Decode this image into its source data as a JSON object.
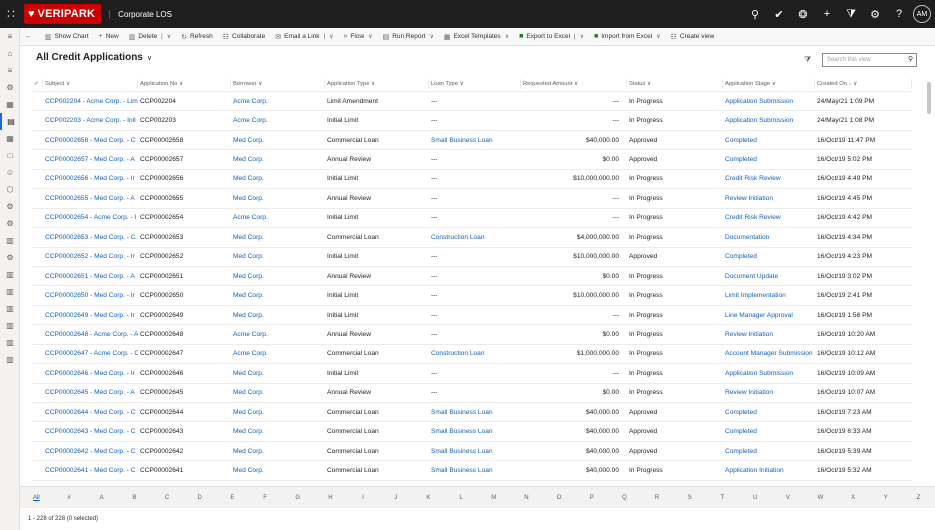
{
  "topbar": {
    "brand": "VERIPARK",
    "app_name": "Corporate LOS",
    "avatar_initials": "AM"
  },
  "commands": [
    {
      "label": "Show Chart",
      "icon": "chart-icon"
    },
    {
      "label": "New",
      "icon": "plus-icon"
    },
    {
      "label": "Delete",
      "icon": "trash-icon"
    },
    {
      "label": "Refresh",
      "icon": "refresh-icon"
    },
    {
      "label": "Collaborate",
      "icon": "collaborate-icon"
    },
    {
      "label": "Email a Link",
      "icon": "email-icon"
    },
    {
      "label": "Flow",
      "icon": "flow-icon"
    },
    {
      "label": "Run Report",
      "icon": "report-icon"
    },
    {
      "label": "Excel Templates",
      "icon": "excel-template-icon"
    },
    {
      "label": "Export to Excel",
      "icon": "excel-icon"
    },
    {
      "label": "Import from Excel",
      "icon": "excel-icon"
    },
    {
      "label": "Create view",
      "icon": "create-view-icon"
    }
  ],
  "view": {
    "title": "All Credit Applications",
    "search_placeholder": "Search this view"
  },
  "columns": [
    "Subject",
    "Application No",
    "Borrower",
    "Application Type",
    "Loan Type",
    "Requested Amount",
    "Status",
    "Application Stage",
    "Created On"
  ],
  "rows": [
    [
      "CCP002204 - Acme Corp. - Lim",
      "CCP002204",
      "Acme Corp.",
      "Limit Amendment",
      "---",
      "---",
      "In Progress",
      "Application Submission",
      "24/May/21 1:09 PM"
    ],
    [
      "CCP002203 - Acme Corp. - Init",
      "CCP002203",
      "Acme Corp.",
      "Initial Limit",
      "---",
      "---",
      "In Progress",
      "Application Submission",
      "24/May/21 1:08 PM"
    ],
    [
      "CCP00002658 - Med Corp. - C",
      "CCP00002658",
      "Med Corp.",
      "Commercial Loan",
      "Small Business Loan",
      "$40,000.00",
      "Approved",
      "Completed",
      "16/Oct/19 11:47 PM"
    ],
    [
      "CCP00002657 - Med Corp. - A",
      "CCP00002657",
      "Med Corp.",
      "Annual Review",
      "---",
      "$0.00",
      "Approved",
      "Completed",
      "16/Oct/19 5:02 PM"
    ],
    [
      "CCP00002656 - Med Corp. - Ir",
      "CCP00002656",
      "Med Corp.",
      "Initial Limit",
      "---",
      "$10,000,000.00",
      "In Progress",
      "Credit Risk Review",
      "16/Oct/19 4:49 PM"
    ],
    [
      "CCP00002655 - Med Corp. - A",
      "CCP00002655",
      "Med Corp.",
      "Annual Review",
      "---",
      "---",
      "In Progress",
      "Review Initiation",
      "16/Oct/19 4:45 PM"
    ],
    [
      "CCP00002654 - Acme Corp. - I",
      "CCP00002654",
      "Acme Corp.",
      "Initial Limit",
      "---",
      "---",
      "In Progress",
      "Credit Risk Review",
      "16/Oct/19 4:42 PM"
    ],
    [
      "CCP00002653 - Med Corp. - C",
      "CCP00002653",
      "Med Corp.",
      "Commercial Loan",
      "Construction Loan",
      "$4,000,000.00",
      "In Progress",
      "Documentation",
      "16/Oct/19 4:34 PM"
    ],
    [
      "CCP00002652 - Med Corp. - Ir",
      "CCP00002652",
      "Med Corp.",
      "Initial Limit",
      "---",
      "$10,000,000.00",
      "Approved",
      "Completed",
      "16/Oct/19 4:23 PM"
    ],
    [
      "CCP00002651 - Med Corp. - A",
      "CCP00002651",
      "Med Corp.",
      "Annual Review",
      "---",
      "$0.00",
      "In Progress",
      "Document Update",
      "16/Oct/19 3:02 PM"
    ],
    [
      "CCP00002650 - Med Corp. - Ir",
      "CCP00002650",
      "Med Corp.",
      "Initial Limit",
      "---",
      "$10,000,000.00",
      "In Progress",
      "Limit Implementation",
      "16/Oct/19 2:41 PM"
    ],
    [
      "CCP00002649 - Med Corp. - Ir",
      "CCP00002649",
      "Med Corp.",
      "Initial Limit",
      "---",
      "---",
      "In Progress",
      "Line Manager Approval",
      "16/Oct/19 1:56 PM"
    ],
    [
      "CCP00002648 - Acme Corp. - A",
      "CCP00002648",
      "Acme Corp.",
      "Annual Review",
      "---",
      "$0.00",
      "In Progress",
      "Review Initiation",
      "16/Oct/19 10:20 AM"
    ],
    [
      "CCP00002647 - Acme Corp. - C",
      "CCP00002647",
      "Acme Corp.",
      "Commercial Loan",
      "Construction Loan",
      "$1,000,000.00",
      "In Progress",
      "Account Manager Submission",
      "16/Oct/19 10:12 AM"
    ],
    [
      "CCP00002646 - Med Corp. - Ir",
      "CCP00002646",
      "Med Corp.",
      "Initial Limit",
      "---",
      "---",
      "In Progress",
      "Application Submission",
      "16/Oct/19 10:09 AM"
    ],
    [
      "CCP00002645 - Med Corp. - A",
      "CCP00002645",
      "Med Corp.",
      "Annual Review",
      "---",
      "$0.00",
      "In Progress",
      "Review Initiation",
      "16/Oct/19 10:07 AM"
    ],
    [
      "CCP00002644 - Med Corp. - C",
      "CCP00002644",
      "Med Corp.",
      "Commercial Loan",
      "Small Business Loan",
      "$40,000.00",
      "Approved",
      "Completed",
      "16/Oct/19 7:23 AM"
    ],
    [
      "CCP00002643 - Med Corp. - C",
      "CCP00002643",
      "Med Corp.",
      "Commercial Loan",
      "Small Business Loan",
      "$40,000.00",
      "Approved",
      "Completed",
      "16/Oct/19 6:33 AM"
    ],
    [
      "CCP00002642 - Med Corp. - C",
      "CCP00002642",
      "Med Corp.",
      "Commercial Loan",
      "Small Business Loan",
      "$40,000.00",
      "Approved",
      "Completed",
      "16/Oct/19 5:39 AM"
    ],
    [
      "CCP00002641 - Med Corp. - C",
      "CCP00002641",
      "Med Corp.",
      "Commercial Loan",
      "Small Business Loan",
      "$40,000.00",
      "In Progress",
      "Application Initiation",
      "16/Oct/19 5:32 AM"
    ]
  ],
  "alphabet": [
    "All",
    "#",
    "A",
    "B",
    "C",
    "D",
    "E",
    "F",
    "G",
    "H",
    "I",
    "J",
    "K",
    "L",
    "M",
    "N",
    "O",
    "P",
    "Q",
    "R",
    "S",
    "T",
    "U",
    "V",
    "W",
    "X",
    "Y",
    "Z"
  ],
  "footer": "1 - 228 of 228 (0 selected)"
}
